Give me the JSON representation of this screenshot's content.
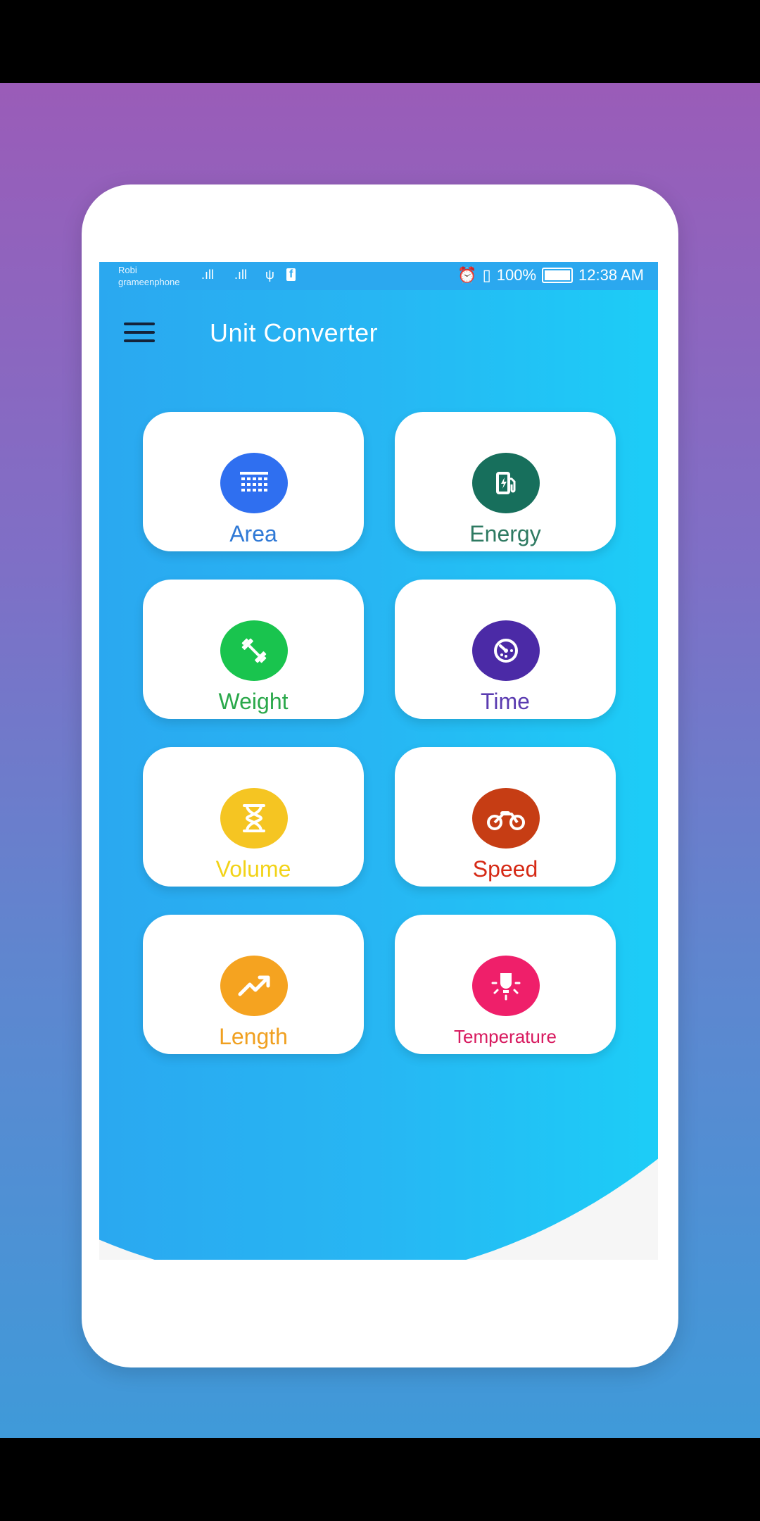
{
  "status_bar": {
    "carrier_line1": "Robi",
    "carrier_line2": "grameenphone",
    "signal1": ".ıll",
    "signal2": ".ıll",
    "usb": "ψ",
    "fb": "f",
    "battery_pct": "100%",
    "time": "12:38 AM"
  },
  "app_bar": {
    "title": "Unit Converter"
  },
  "categories": [
    {
      "label": "Area",
      "icon": "grid-calculator-icon",
      "color": "#2f6ff0",
      "label_color": "#2f79d6"
    },
    {
      "label": "Energy",
      "icon": "fuel-station-icon",
      "color": "#176f5c",
      "label_color": "#2e7a62"
    },
    {
      "label": "Weight",
      "icon": "dumbbell-icon",
      "color": "#19c44e",
      "label_color": "#2aa84a"
    },
    {
      "label": "Time",
      "icon": "timer-icon",
      "color": "#4b2aa6",
      "label_color": "#5a3bb0"
    },
    {
      "label": "Volume",
      "icon": "hourglass-icon",
      "color": "#f5c522",
      "label_color": "#f2d318"
    },
    {
      "label": "Speed",
      "icon": "motorbike-icon",
      "color": "#c63d14",
      "label_color": "#d62a16"
    },
    {
      "label": "Length",
      "icon": "trending-up-icon",
      "color": "#f5a320",
      "label_color": "#f0a020"
    },
    {
      "label": "Temperature",
      "icon": "light-bulb-icon",
      "color": "#ef1f6a",
      "label_color": "#d81b60"
    }
  ]
}
